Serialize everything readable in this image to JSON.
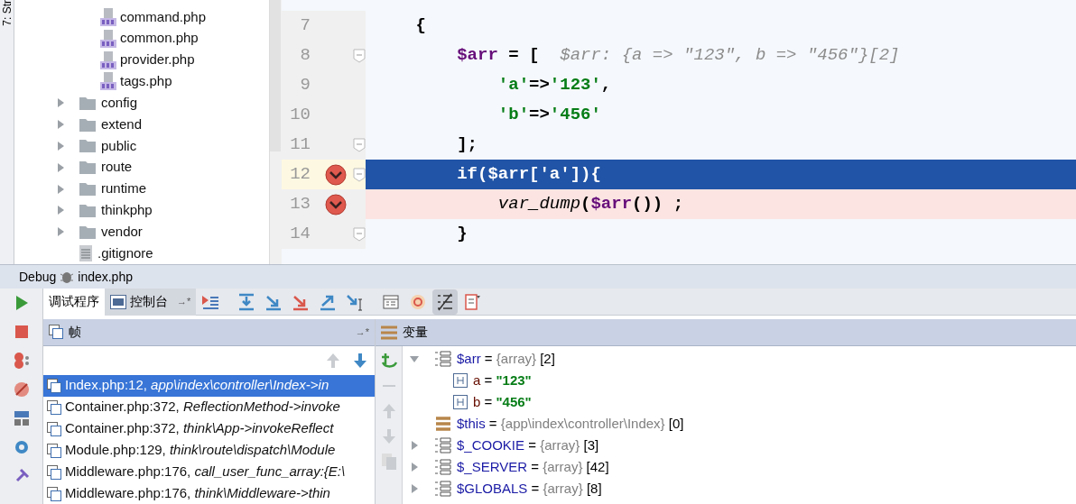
{
  "side_tab": {
    "label": "7: Str"
  },
  "project_tree": {
    "nested_files": [
      {
        "kind": "php",
        "label": "command.php"
      },
      {
        "kind": "php",
        "label": "common.php"
      },
      {
        "kind": "php",
        "label": "provider.php"
      },
      {
        "kind": "php",
        "label": "tags.php"
      }
    ],
    "items": [
      {
        "kind": "folder",
        "label": "config",
        "expanded": false
      },
      {
        "kind": "folder",
        "label": "extend",
        "expanded": false
      },
      {
        "kind": "folder",
        "label": "public",
        "expanded": false
      },
      {
        "kind": "folder",
        "label": "route",
        "expanded": false
      },
      {
        "kind": "folder",
        "label": "runtime",
        "expanded": false
      },
      {
        "kind": "folder",
        "label": "thinkphp",
        "expanded": false
      },
      {
        "kind": "folder",
        "label": "vendor",
        "expanded": false
      },
      {
        "kind": "text",
        "label": ".gitignore"
      }
    ]
  },
  "editor": {
    "lines": [
      {
        "number": "7",
        "breakpoint": false,
        "current": false,
        "fold": false,
        "tokens": [
          {
            "kind": "punct",
            "text": "    {"
          }
        ]
      },
      {
        "number": "8",
        "breakpoint": false,
        "current": false,
        "fold": true,
        "tokens": [
          {
            "kind": "var",
            "text": "        $arr"
          },
          {
            "kind": "punct",
            "text": " = [  "
          },
          {
            "kind": "hint",
            "text": "$arr: {a => \"123\", b => \"456\"}[2]"
          }
        ]
      },
      {
        "number": "9",
        "breakpoint": false,
        "current": false,
        "fold": false,
        "tokens": [
          {
            "kind": "string",
            "text": "            'a'"
          },
          {
            "kind": "punct",
            "text": "=>"
          },
          {
            "kind": "string",
            "text": "'123'"
          },
          {
            "kind": "punct",
            "text": ","
          }
        ]
      },
      {
        "number": "10",
        "breakpoint": false,
        "current": false,
        "fold": false,
        "tokens": [
          {
            "kind": "string",
            "text": "            'b'"
          },
          {
            "kind": "punct",
            "text": "=>"
          },
          {
            "kind": "string",
            "text": "'456'"
          }
        ]
      },
      {
        "number": "11",
        "breakpoint": false,
        "current": false,
        "fold": true,
        "tokens": [
          {
            "kind": "punct",
            "text": "        ];"
          }
        ]
      },
      {
        "number": "12",
        "breakpoint": true,
        "current": true,
        "fold": true,
        "tokens": [
          {
            "kind": "punct",
            "text": "        if("
          },
          {
            "kind": "var",
            "text": "$arr"
          },
          {
            "kind": "punct",
            "text": "['a']){"
          }
        ]
      },
      {
        "number": "13",
        "breakpoint": true,
        "current": false,
        "fold": false,
        "tokens": [
          {
            "kind": "func",
            "text": "            var_dump"
          },
          {
            "kind": "punct",
            "text": "("
          },
          {
            "kind": "var",
            "text": "$arr"
          },
          {
            "kind": "punct",
            "text": "()) ;"
          }
        ]
      },
      {
        "number": "14",
        "breakpoint": false,
        "current": false,
        "fold": true,
        "tokens": [
          {
            "kind": "punct",
            "text": "        }"
          }
        ]
      }
    ]
  },
  "debug": {
    "title": "Debug",
    "config": "index.php",
    "tabs": [
      {
        "label": "调试程序",
        "selected": true
      },
      {
        "label": "控制台",
        "selected": false,
        "pin": "→*"
      }
    ],
    "frames": {
      "title": "帧",
      "pin": "→*",
      "rows": [
        {
          "location": "Index.php:12,",
          "method": "app\\index\\controller\\Index->in",
          "selected": true
        },
        {
          "location": "Container.php:372,",
          "method": "ReflectionMethod->invoke",
          "selected": false
        },
        {
          "location": "Container.php:372,",
          "method": "think\\App->invokeReflect",
          "selected": false
        },
        {
          "location": "Module.php:129,",
          "method": "think\\route\\dispatch\\Module",
          "selected": false
        },
        {
          "location": "Middleware.php:176,",
          "method": "call_user_func_array:{E:\\",
          "selected": false
        },
        {
          "location": "Middleware.php:176,",
          "method": "think\\Middleware->thin",
          "selected": false
        }
      ]
    },
    "variables": {
      "title": "变量",
      "items": [
        {
          "kind": "array",
          "name": "$arr",
          "sep": "=",
          "type": "{array}",
          "count": "[2]",
          "expanded": true,
          "children": [
            {
              "kind": "scalar",
              "name": "a",
              "sep": "=",
              "value": "\"123\""
            },
            {
              "kind": "scalar",
              "name": "b",
              "sep": "=",
              "value": "\"456\""
            }
          ]
        },
        {
          "kind": "object",
          "name": "$this",
          "sep": "=",
          "type": "{app\\index\\controller\\Index}",
          "count": "[0]"
        },
        {
          "kind": "array",
          "name": "$_COOKIE",
          "sep": "=",
          "type": "{array}",
          "count": "[3]",
          "expanded": false
        },
        {
          "kind": "array",
          "name": "$_SERVER",
          "sep": "=",
          "type": "{array}",
          "count": "[42]",
          "expanded": false
        },
        {
          "kind": "array",
          "name": "$GLOBALS",
          "sep": "=",
          "type": "{array}",
          "count": "[8]",
          "expanded": false
        }
      ]
    }
  }
}
